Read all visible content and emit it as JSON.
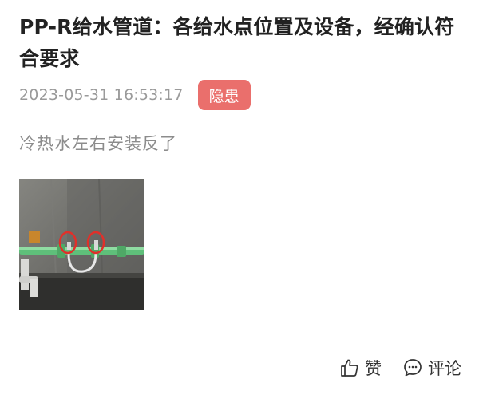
{
  "post": {
    "title": "PP-R给水管道：各给水点位置及设备，经确认符合要求",
    "timestamp": "2023-05-31 16:53:17",
    "badge": "隐患",
    "description": "冷热水左右安装反了"
  },
  "actions": {
    "like_label": "赞",
    "comment_label": "评论"
  },
  "colors": {
    "badge_bg": "#ea6f6c",
    "timestamp": "#9a9a9a",
    "description": "#8c8c8c",
    "pipe": "#5fbf7a",
    "annotation": "#e0302a"
  },
  "icons": {
    "like": "thumbs-up-icon",
    "comment": "speech-bubble-icon"
  }
}
